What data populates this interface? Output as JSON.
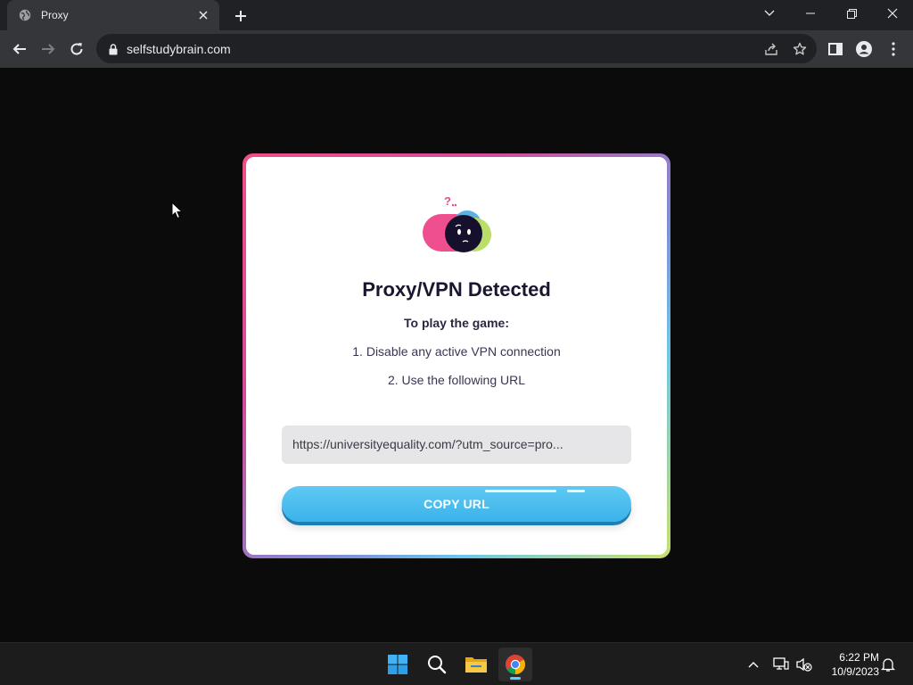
{
  "browser": {
    "tab": {
      "title": "Proxy"
    },
    "url": "selfstudybrain.com"
  },
  "modal": {
    "title": "Proxy/VPN Detected",
    "subtitle": "To play the game:",
    "steps": [
      "1. Disable any active VPN connection",
      "2. Use the following URL"
    ],
    "url_value": "https://universityequality.com/?utm_source=pro...",
    "copy_button_label": "COPY URL"
  },
  "colors": {
    "accent_blue": "#3ab3ea",
    "frame_pink": "#f04e86",
    "frame_lime": "#c8e06a"
  },
  "taskbar": {
    "apps": [
      "windows-start",
      "search",
      "file-explorer",
      "chrome"
    ],
    "time": "6:22 PM",
    "date": "10/9/2023"
  }
}
